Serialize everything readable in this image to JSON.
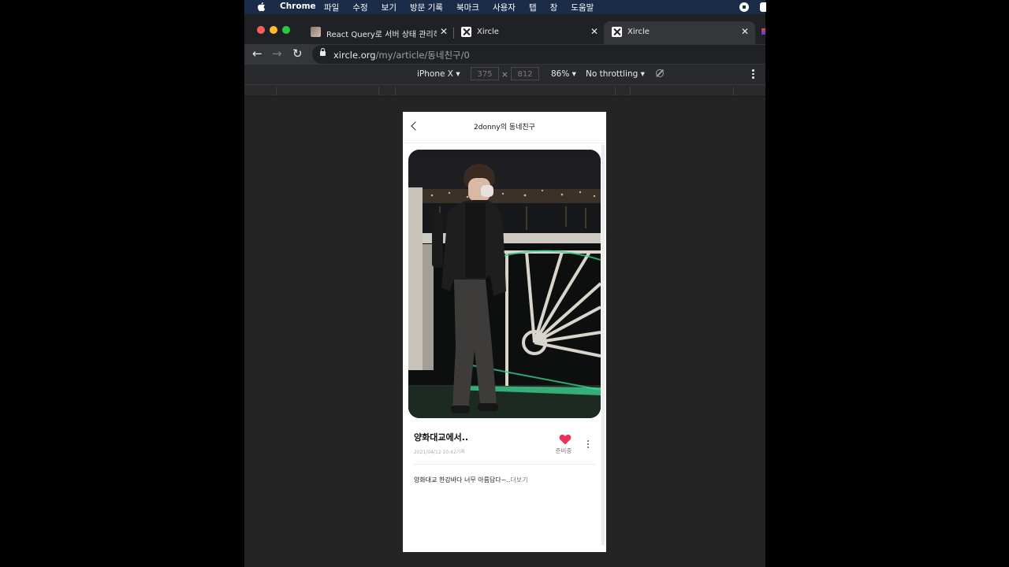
{
  "menubar": {
    "app_name": "Chrome",
    "items": [
      "파일",
      "수정",
      "보기",
      "방문 기록",
      "북마크",
      "사용자",
      "탭",
      "창",
      "도움말"
    ]
  },
  "tabs": [
    {
      "title": "React Query로 서버 상태 관리하기",
      "icon": "thumbnail-favicon"
    },
    {
      "title": "Xircle",
      "icon": "xircle-favicon"
    },
    {
      "title": "Xircle",
      "icon": "xircle-favicon",
      "active": true
    }
  ],
  "address_bar": {
    "host": "xircle.org",
    "path": "/my/article/동네친구/0"
  },
  "device_toolbar": {
    "device": "iPhone X",
    "width": "375",
    "height": "812",
    "times": "×",
    "zoom": "86%",
    "throttling": "No throttling"
  },
  "page": {
    "header_title": "2donny의 동네친구",
    "post_title": "양화대교에서..",
    "post_date": "2021/04/12 10:42기록",
    "like_label": "준비중",
    "body_text": "양화대교 한강바다 너무 아름답다~..",
    "more_link": "더보기"
  },
  "colors": {
    "menubar": "#1b2c49",
    "heart": "#e8345a",
    "traffic_lights": [
      "#ff5f57",
      "#febc2e",
      "#28c840"
    ]
  }
}
